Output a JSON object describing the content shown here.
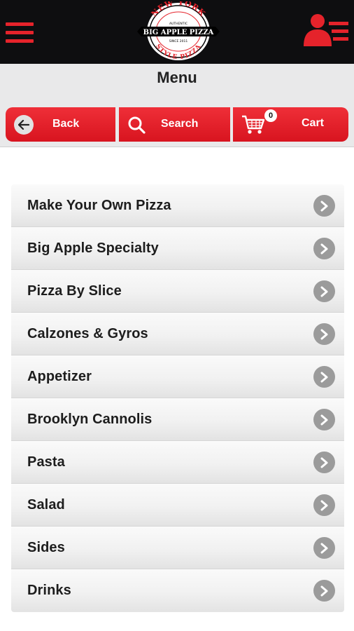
{
  "header": {
    "logo_lines": {
      "arc_top": "NEW YORK",
      "established": "AUTHENTIC",
      "brand": "BIG APPLE PIZZA",
      "since": "SINCE 2011",
      "arc_bottom": "STYLE PIZZA"
    }
  },
  "title": "Menu",
  "nav": {
    "back_label": "Back",
    "search_label": "Search",
    "cart_label": "Cart",
    "cart_count": "0"
  },
  "menu": {
    "items": [
      {
        "label": "Make Your Own Pizza"
      },
      {
        "label": "Big Apple Specialty"
      },
      {
        "label": "Pizza By Slice"
      },
      {
        "label": "Calzones & Gyros"
      },
      {
        "label": "Appetizer"
      },
      {
        "label": "Brooklyn Cannolis"
      },
      {
        "label": "Pasta"
      },
      {
        "label": "Salad"
      },
      {
        "label": "Sides"
      },
      {
        "label": "Drinks"
      }
    ]
  },
  "colors": {
    "accent": "#e5232b",
    "header_bg": "#0e0e10",
    "title_bg": "#e9e9ea",
    "arrow": "#9b9b9b"
  },
  "icons": [
    "hamburger-menu-icon",
    "brand-logo",
    "account-list-icon",
    "back-arrow-icon",
    "search-icon",
    "cart-icon",
    "chevron-right-icon"
  ]
}
